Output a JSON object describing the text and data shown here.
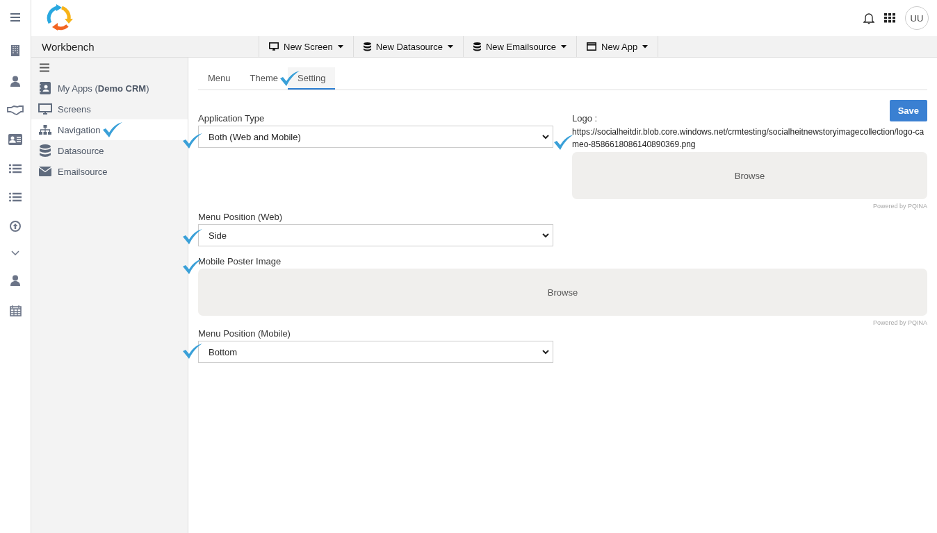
{
  "header": {
    "avatar": "UU"
  },
  "workbench": {
    "title": "Workbench"
  },
  "toolbar": [
    {
      "label": "New Screen"
    },
    {
      "label": "New Datasource"
    },
    {
      "label": "New Emailsource"
    },
    {
      "label": "New App"
    }
  ],
  "sidebar": {
    "items": [
      {
        "label": "My Apps (**Demo CRM**)",
        "selected": false
      },
      {
        "label": "Screens",
        "selected": false
      },
      {
        "label": "Navigation",
        "selected": true
      },
      {
        "label": "Datasource",
        "selected": false
      },
      {
        "label": "Emailsource",
        "selected": false
      }
    ]
  },
  "tabs": [
    {
      "label": "Menu",
      "selected": false
    },
    {
      "label": "Theme",
      "selected": false
    },
    {
      "label": "Setting",
      "selected": true
    }
  ],
  "save_button": "Save",
  "application_type": {
    "label": "Application Type",
    "value": "Both (Web and Mobile)"
  },
  "logo": {
    "label": "Logo :",
    "url": "https://socialheitdir.blob.core.windows.net/crmtesting/socialheitnewstoryimagecollection/logo-cameo-8586618086140890369.png",
    "button": "Browse",
    "credit": "Powered by PQINA"
  },
  "menu_position_web": {
    "label": "Menu Position (Web)",
    "value": "Side"
  },
  "mobile_poster": {
    "label": "Mobile Poster Image",
    "button": "Browse",
    "credit": "Powered by PQINA"
  },
  "menu_position_mobile": {
    "label": "Menu Position (Mobile)",
    "value": "Bottom"
  }
}
